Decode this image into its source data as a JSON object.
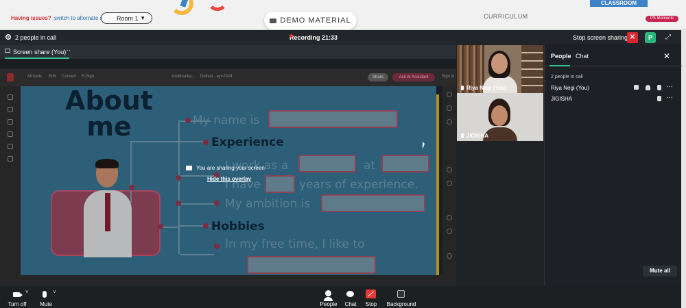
{
  "topbar": {
    "issues_text": "Having issues?",
    "alternate_link": "switch to alternate room",
    "room_label": "Room 1",
    "room_caret": "▼",
    "demo_label": "DEMO MATERIAL",
    "curriculum_label": "CURRICULUM",
    "classroom_label": "CLASSROOM",
    "ps_badge": "PS Moments"
  },
  "callbar": {
    "people_count": "2 people in call",
    "recording": "Recording 21:33",
    "stop_screen_sharing": "Stop screen sharing",
    "close_glyph": "✕",
    "avatar_letter": "P",
    "expand_glyph": "⤢"
  },
  "share": {
    "tab_label": "Screen share (You)",
    "more": "···",
    "overlay_message": "You are sharing your screen",
    "overlay_hide": "Hide this overlay",
    "acrobat": {
      "toolbar_items": [
        "All tools",
        "Edit",
        "Convert",
        "E-Sign"
      ],
      "filename": "shubhanka...",
      "filename2": "Deliver...ay=2024",
      "share_btn": "Share",
      "ai_btn": "Ask AI Assistant",
      "sign_in": "Sign in"
    },
    "slide": {
      "title_line1": "About",
      "title_line2": "me",
      "items": [
        "My name is",
        "Experience",
        "I work as a",
        "at",
        "I have",
        "years of experience.",
        "My ambition is",
        "Hobbies",
        "In my free time, I like to"
      ]
    }
  },
  "videos": [
    {
      "name": "Riya Negi (You)"
    },
    {
      "name": "JIGISHA"
    }
  ],
  "panel": {
    "tab_people": "People",
    "tab_chat": "Chat",
    "close": "✕",
    "count": "2 people in call",
    "participants": [
      {
        "name": "Riya Negi (You)"
      },
      {
        "name": "JIGISHA"
      }
    ],
    "row_more": "···",
    "mute_all": "Mute all"
  },
  "bottombar": {
    "turn_off": "Turn off",
    "mute": "Mute",
    "chevron": "˅",
    "people": "People",
    "chat": "Chat",
    "stop": "Stop",
    "background": "Background"
  }
}
